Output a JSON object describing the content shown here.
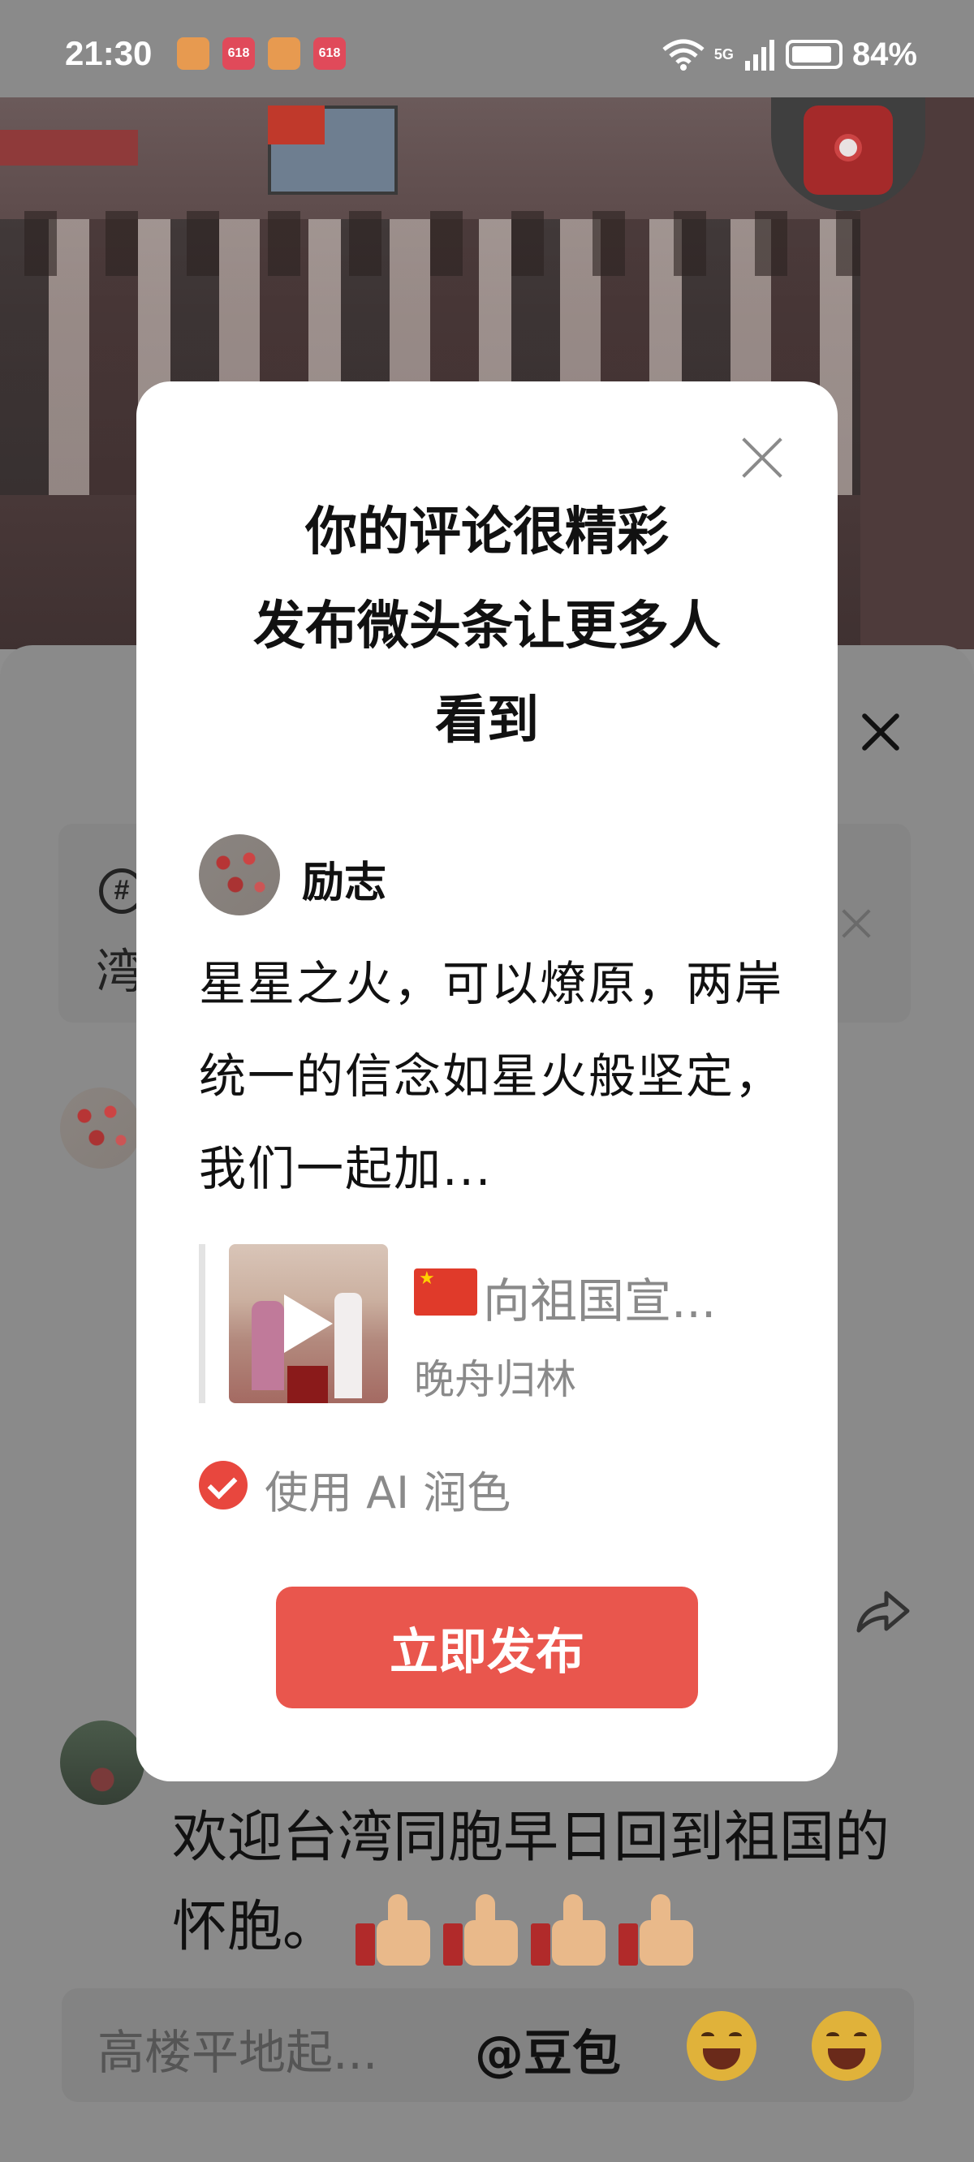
{
  "status_bar": {
    "time": "21:30",
    "badges": [
      "heart-badge",
      "618-badge",
      "heart-badge",
      "618-badge"
    ],
    "badge_text": "618",
    "network": "5G",
    "battery": "84%"
  },
  "sheet": {
    "topic": {
      "prefix": "#",
      "text": "湾"
    },
    "comment_text": "欢迎台湾同胞早日回到祖国的怀胞。",
    "input": {
      "placeholder": "高楼平地起...",
      "mention": "@豆包"
    }
  },
  "dialog": {
    "title_lines": [
      "你的评论很精彩",
      "发布微头条让更多人",
      "看到"
    ],
    "author": "励志",
    "body": "星星之火，可以燎原，两岸统一的信念如星火般坚定，我们一起加...",
    "quote": {
      "title": "向祖国宣...",
      "author": "晚舟归林"
    },
    "ai_option": "使用 AI 润色",
    "publish_button": "立即发布"
  },
  "colors": {
    "accent": "#e9564d",
    "check": "#e8473e",
    "muted": "#8a8a8a"
  }
}
